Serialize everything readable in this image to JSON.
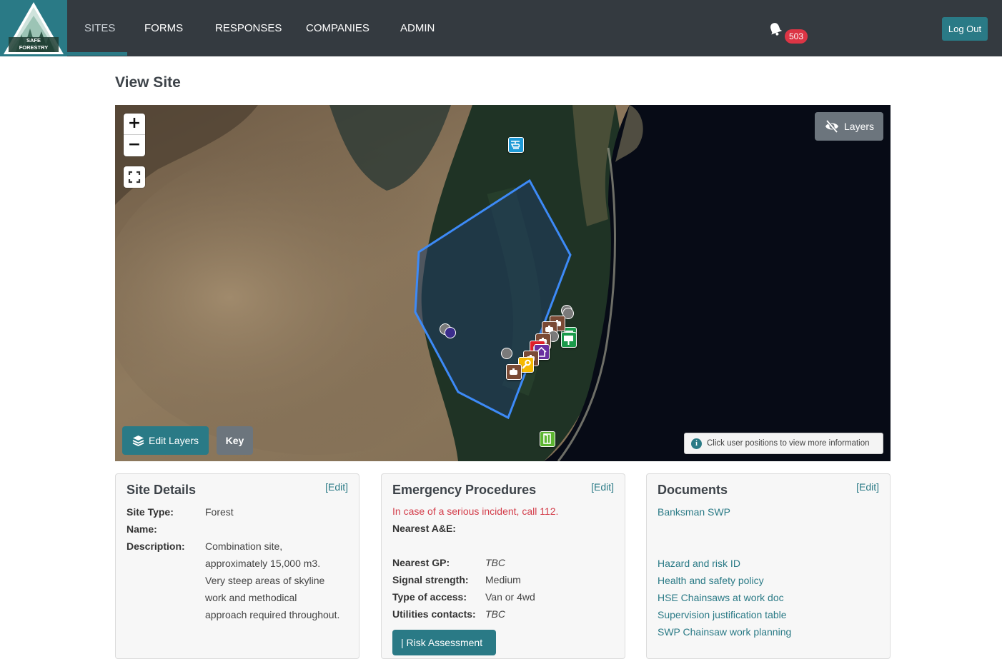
{
  "app": {
    "logo_line1": "SAFE",
    "logo_line2": "FORESTRY",
    "nav": [
      {
        "label": "SITES",
        "active": true
      },
      {
        "label": "FORMS",
        "active": false
      },
      {
        "label": "RESPONSES",
        "active": false
      },
      {
        "label": "COMPANIES",
        "active": false
      },
      {
        "label": "ADMIN",
        "active": false
      }
    ],
    "notifications_count": "503",
    "logout_label": "Log Out",
    "accent_color": "#2a7a86",
    "navbar_color": "#343a40"
  },
  "page": {
    "title": "View Site"
  },
  "map": {
    "zoom_in": "+",
    "zoom_out": "−",
    "layers_label": "Layers",
    "edit_layers_label": "Edit Layers",
    "key_label": "Key",
    "info_text": "Click user positions to view more information",
    "markers": [
      {
        "type": "helipad",
        "color": "#1e9ad6"
      },
      {
        "type": "exit",
        "color": "#5cb531"
      },
      {
        "type": "signboard",
        "color": "#1b9a4b"
      },
      {
        "type": "signboard",
        "color": "#1b9a4b"
      },
      {
        "type": "machine",
        "color": "#7a4a35"
      },
      {
        "type": "machine",
        "color": "#7a4a35"
      },
      {
        "type": "machine",
        "color": "#7a4a35"
      },
      {
        "type": "machine",
        "color": "#7a4a35"
      },
      {
        "type": "machine",
        "color": "#7a4a35"
      },
      {
        "type": "first-aid",
        "color": "#e0202a"
      },
      {
        "type": "welfare",
        "color": "#6a2fa0"
      },
      {
        "type": "workshop",
        "color": "#f5b800"
      }
    ]
  },
  "site_details": {
    "title": "Site Details",
    "edit_label": "[Edit]",
    "fields": [
      {
        "label": "Site Type:",
        "value": "Forest"
      },
      {
        "label": "Name:",
        "value": ""
      },
      {
        "label": "Description:",
        "value": "Combination site, approximately 15,000 m3. Very steep areas of skyline work and methodical approach required throughout."
      }
    ]
  },
  "emergency": {
    "title": "Emergency Procedures",
    "edit_label": "[Edit]",
    "alert": "In case of a serious incident, call 112.",
    "fields": [
      {
        "label": "Nearest A&E:",
        "value": ""
      },
      {
        "label": "Nearest GP:",
        "value": "TBC"
      },
      {
        "label": "Signal strength:",
        "value": "Medium"
      },
      {
        "label": "Type of access:",
        "value": "Van or 4wd"
      },
      {
        "label": "Utilities contacts:",
        "value": "TBC"
      }
    ],
    "risk_button": "| Risk Assessment"
  },
  "documents": {
    "title": "Documents",
    "edit_label": "[Edit]",
    "items": [
      "Banksman SWP",
      "Hazard and risk ID",
      "Health and safety policy",
      "HSE Chainsaws at work doc",
      "Supervision justification table",
      "SWP Chainsaw work planning"
    ]
  }
}
